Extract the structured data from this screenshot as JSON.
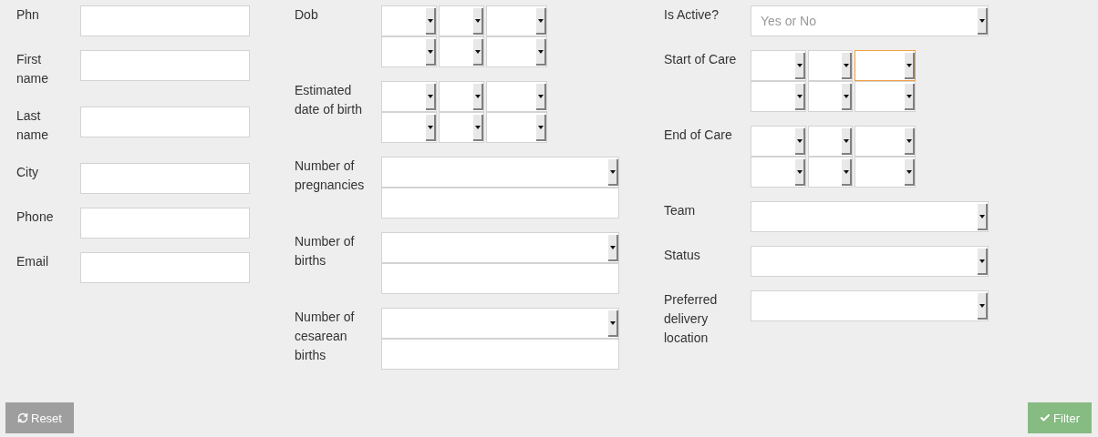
{
  "columns": [
    {
      "fields": [
        {
          "label": "Phn",
          "kind": "text"
        },
        {
          "label": "First name",
          "kind": "text"
        },
        {
          "label": "Last name",
          "kind": "text"
        },
        {
          "label": "City",
          "kind": "text"
        },
        {
          "label": "Phone",
          "kind": "text"
        },
        {
          "label": "Email",
          "kind": "text"
        }
      ]
    },
    {
      "fields": [
        {
          "label": "Dob",
          "kind": "date_range",
          "parts": [
            {
              "focused": false
            },
            {
              "focused": false
            },
            {
              "focused": false
            },
            {
              "focused": false
            },
            {
              "focused": false
            },
            {
              "focused": false
            }
          ]
        },
        {
          "label": "Estimated date of birth",
          "kind": "date_range",
          "parts": [
            {
              "focused": false
            },
            {
              "focused": false
            },
            {
              "focused": false
            },
            {
              "focused": false
            },
            {
              "focused": false
            },
            {
              "focused": false
            }
          ]
        },
        {
          "label": "Number of pregnancies",
          "kind": "select_text"
        },
        {
          "label": "Number of births",
          "kind": "select_text"
        },
        {
          "label": "Number of cesarean births",
          "kind": "select_text"
        }
      ]
    },
    {
      "fields": [
        {
          "label": "Is Active?",
          "kind": "select",
          "placeholder": "Yes or No"
        },
        {
          "label": "Start of Care",
          "kind": "date_range",
          "parts": [
            {
              "focused": false
            },
            {
              "focused": false
            },
            {
              "focused": true
            },
            {
              "focused": false
            },
            {
              "focused": false
            },
            {
              "focused": false
            }
          ]
        },
        {
          "label": "End of Care",
          "kind": "date_range",
          "parts": [
            {
              "focused": false
            },
            {
              "focused": false
            },
            {
              "focused": false
            },
            {
              "focused": false
            },
            {
              "focused": false
            },
            {
              "focused": false
            }
          ]
        },
        {
          "label": "Team",
          "kind": "select"
        },
        {
          "label": "Status",
          "kind": "select"
        },
        {
          "label": "Preferred delivery location",
          "kind": "select"
        }
      ]
    }
  ],
  "buttons": [
    {
      "label": "Reset",
      "kind": "reset"
    },
    {
      "label": "Filter",
      "kind": "filter"
    }
  ]
}
